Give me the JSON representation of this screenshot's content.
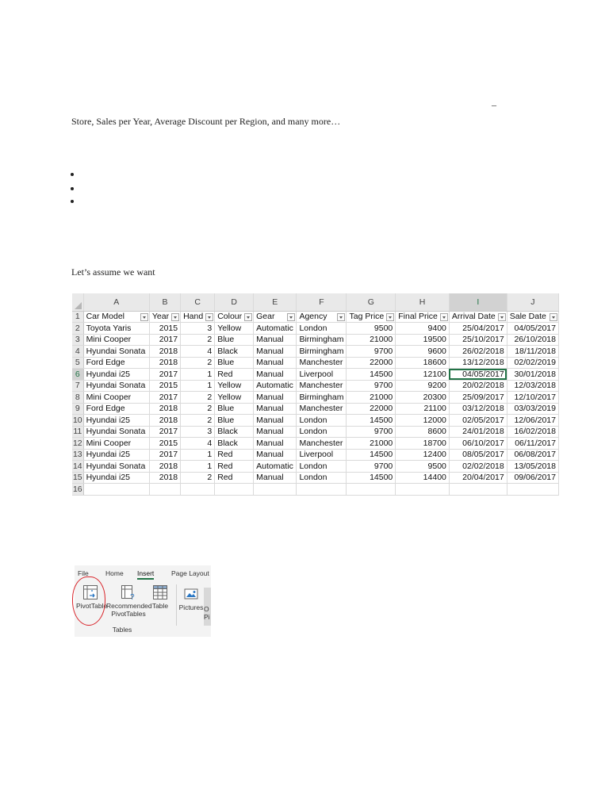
{
  "document": {
    "dash_text": "–",
    "paragraph_tail": "Store, Sales per Year, Average Discount per Region, and many more…",
    "bullets": [
      "",
      "",
      ""
    ],
    "assume_text": "Let’s assume we want"
  },
  "spreadsheet": {
    "column_letters": [
      "A",
      "B",
      "C",
      "D",
      "E",
      "F",
      "G",
      "H",
      "I",
      "J"
    ],
    "active_column": "I",
    "active_row": "6",
    "selected_cell": "I6",
    "headers": [
      "Car Model",
      "Year",
      "Hand",
      "Colour",
      "Gear",
      "Agency",
      "Tag Price",
      "Final Price",
      "Arrival Date",
      "Sale Date"
    ],
    "rows": [
      {
        "n": "2",
        "cells": [
          "Toyota Yaris",
          "2015",
          "3",
          "Yellow",
          "Automatic",
          "London",
          "9500",
          "9400",
          "25/04/2017",
          "04/05/2017"
        ]
      },
      {
        "n": "3",
        "cells": [
          "Mini Cooper",
          "2017",
          "2",
          "Blue",
          "Manual",
          "Birmingham",
          "21000",
          "19500",
          "25/10/2017",
          "26/10/2018"
        ]
      },
      {
        "n": "4",
        "cells": [
          "Hyundai Sonata",
          "2018",
          "4",
          "Black",
          "Manual",
          "Birmingham",
          "9700",
          "9600",
          "26/02/2018",
          "18/11/2018"
        ]
      },
      {
        "n": "5",
        "cells": [
          "Ford Edge",
          "2018",
          "2",
          "Blue",
          "Manual",
          "Manchester",
          "22000",
          "18600",
          "13/12/2018",
          "02/02/2019"
        ]
      },
      {
        "n": "6",
        "cells": [
          "Hyundai i25",
          "2017",
          "1",
          "Red",
          "Manual",
          "Liverpool",
          "14500",
          "12100",
          "04/05/2017",
          "30/01/2018"
        ]
      },
      {
        "n": "7",
        "cells": [
          "Hyundai Sonata",
          "2015",
          "1",
          "Yellow",
          "Automatic",
          "Manchester",
          "9700",
          "9200",
          "20/02/2018",
          "12/03/2018"
        ]
      },
      {
        "n": "8",
        "cells": [
          "Mini Cooper",
          "2017",
          "2",
          "Yellow",
          "Manual",
          "Birmingham",
          "21000",
          "20300",
          "25/09/2017",
          "12/10/2017"
        ]
      },
      {
        "n": "9",
        "cells": [
          "Ford Edge",
          "2018",
          "2",
          "Blue",
          "Manual",
          "Manchester",
          "22000",
          "21100",
          "03/12/2018",
          "03/03/2019"
        ]
      },
      {
        "n": "10",
        "cells": [
          "Hyundai i25",
          "2018",
          "2",
          "Blue",
          "Manual",
          "London",
          "14500",
          "12000",
          "02/05/2017",
          "12/06/2017"
        ]
      },
      {
        "n": "11",
        "cells": [
          "Hyundai Sonata",
          "2017",
          "3",
          "Black",
          "Manual",
          "London",
          "9700",
          "8600",
          "24/01/2018",
          "16/02/2018"
        ]
      },
      {
        "n": "12",
        "cells": [
          "Mini Cooper",
          "2015",
          "4",
          "Black",
          "Manual",
          "Manchester",
          "21000",
          "18700",
          "06/10/2017",
          "06/11/2017"
        ]
      },
      {
        "n": "13",
        "cells": [
          "Hyundai i25",
          "2017",
          "1",
          "Red",
          "Manual",
          "Liverpool",
          "14500",
          "12400",
          "08/05/2017",
          "06/08/2017"
        ]
      },
      {
        "n": "14",
        "cells": [
          "Hyundai Sonata",
          "2018",
          "1",
          "Red",
          "Automatic",
          "London",
          "9700",
          "9500",
          "02/02/2018",
          "13/05/2018"
        ]
      },
      {
        "n": "15",
        "cells": [
          "Hyundai i25",
          "2018",
          "2",
          "Red",
          "Manual",
          "London",
          "14500",
          "14400",
          "20/04/2017",
          "09/06/2017"
        ]
      }
    ],
    "last_row_number": "16",
    "grid_accent": "#217346"
  },
  "ribbon": {
    "tabs": [
      {
        "label": "File",
        "active": false
      },
      {
        "label": "Home",
        "active": false
      },
      {
        "label": "Insert",
        "active": true
      },
      {
        "label": "Page Layout",
        "active": false
      }
    ],
    "buttons": {
      "pivot_table": "PivotTable",
      "recommended_line1": "Recommended",
      "recommended_line2": "PivotTables",
      "table": "Table",
      "pictures": "Pictures",
      "cut_o": "O",
      "cut_pi": "Pi"
    },
    "group_label": "Tables",
    "highlight_color": "#d9262c"
  }
}
